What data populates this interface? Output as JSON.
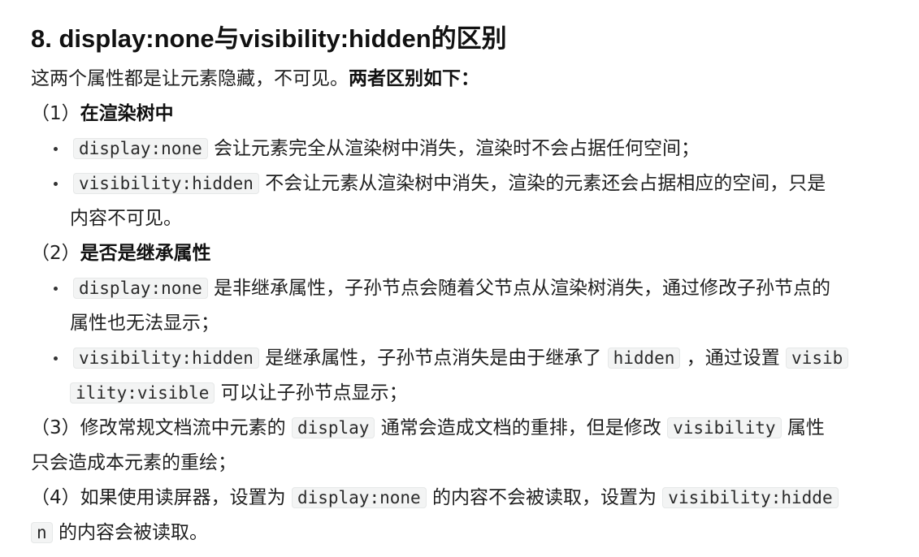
{
  "title": "8. display:none与visibility:hidden的区别",
  "intro": {
    "text": "这两个属性都是让元素隐藏，不可见。",
    "bold": "两者区别如下："
  },
  "s1": {
    "num": "（1）",
    "heading": "在渲染树中",
    "b1": {
      "code": "display:none",
      "text": " 会让元素完全从渲染树中消失，渲染时不会占据任何空间；"
    },
    "b2": {
      "code": "visibility:hidden",
      "text": " 不会让元素从渲染树中消失，渲染的元素还会占据相应的空间，只是",
      "text2": "内容不可见。"
    }
  },
  "s2": {
    "num": "（2）",
    "heading": "是否是继承属性",
    "b1": {
      "code": "display:none",
      "text": " 是非继承属性，子孙节点会随着父节点从渲染树消失，通过修改子孙节点的",
      "text2": "属性也无法显示；"
    },
    "b2": {
      "code": "visibility:hidden",
      "text_a": " 是继承属性，子孙节点消失是由于继承了 ",
      "code2": "hidden",
      "text_b": " ，通过设置 ",
      "code3_a": "visib",
      "code3_b": "ility:visible",
      "text_c": " 可以让子孙节点显示；"
    }
  },
  "s3": {
    "num": "（3）",
    "text_a": "修改常规文档流中元素的 ",
    "code1": "display",
    "text_b": " 通常会造成文档的重排，但是修改 ",
    "code2": "visibility",
    "text_c": " 属性",
    "line2": "只会造成本元素的重绘；"
  },
  "s4": {
    "num": "（4）",
    "text_a": "如果使用读屏器，设置为 ",
    "code1": "display:none",
    "text_b": " 的内容不会被读取，设置为 ",
    "code2_a": "visibility:hidde",
    "code2_b": "n",
    "text_c": " 的内容会被读取。"
  }
}
